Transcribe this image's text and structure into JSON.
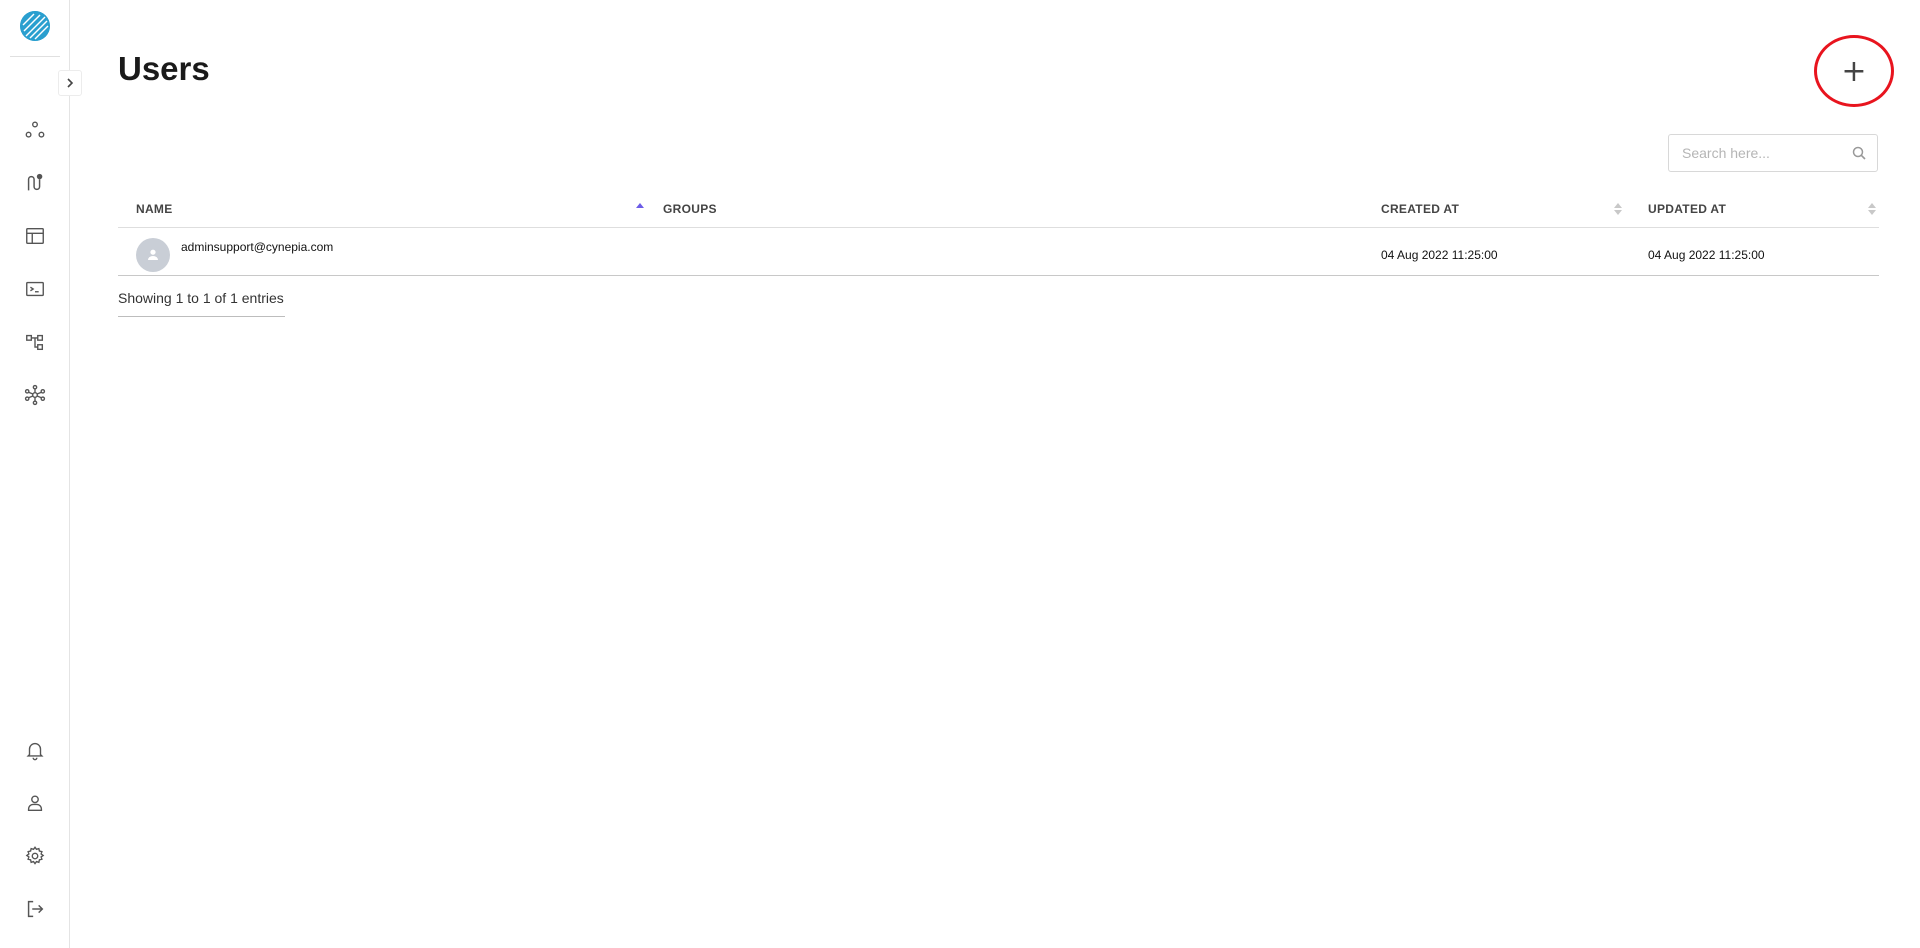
{
  "page": {
    "title": "Users"
  },
  "header": {
    "add_label": "+"
  },
  "search": {
    "placeholder": "Search here..."
  },
  "table": {
    "columns": [
      {
        "key": "name",
        "label": "NAME",
        "sort": "ascending"
      },
      {
        "key": "groups",
        "label": "GROUPS",
        "sort": "none"
      },
      {
        "key": "created_at",
        "label": "CREATED AT",
        "sort": "unsorted"
      },
      {
        "key": "updated_at",
        "label": "UPDATED AT",
        "sort": "unsorted"
      }
    ],
    "rows": [
      {
        "name": "adminsupport@cynepia.com",
        "groups": "",
        "created_at": "04 Aug 2022 11:25:00",
        "updated_at": "04 Aug 2022 11:25:00"
      }
    ],
    "info": "Showing 1 to 1 of 1 entries"
  },
  "sidebar": {
    "top_items": [
      "workflows-icon",
      "pipelines-icon",
      "datasets-icon",
      "terminal-icon",
      "hierarchy-icon",
      "network-icon"
    ],
    "bottom_items": [
      "bell-icon",
      "user-icon",
      "gear-icon",
      "logout-icon"
    ]
  },
  "colors": {
    "accent": "#6c5ce7",
    "highlight": "#e8141e",
    "logo": "#2a9fcf"
  }
}
